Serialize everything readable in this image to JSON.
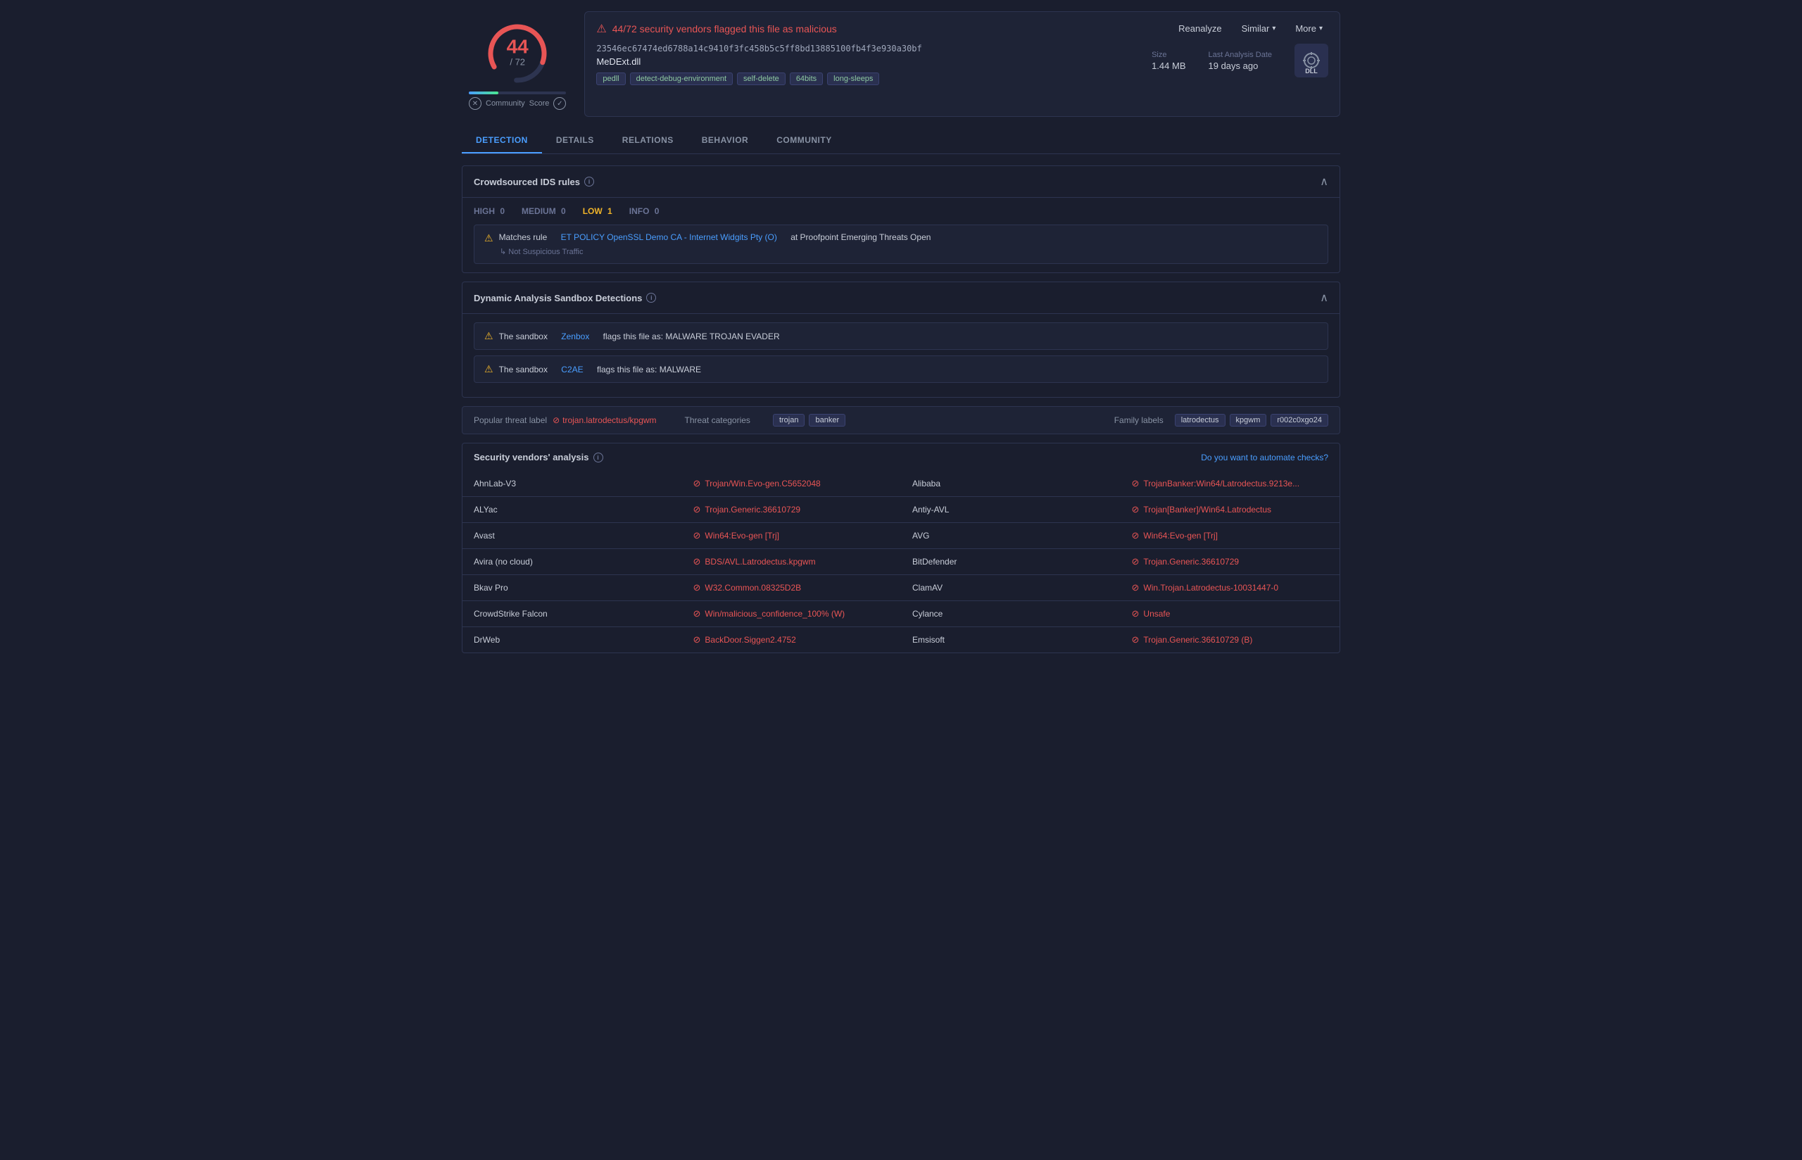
{
  "header": {
    "alert": {
      "text": "44/72 security vendors flagged this file as malicious",
      "reanalyze_label": "Reanalyze",
      "similar_label": "Similar",
      "more_label": "More"
    },
    "file": {
      "hash": "23546ec67474ed6788a14c9410f3fc458b5c5ff8bd13885100fb4f3e930a30bf",
      "name": "MeDExt.dll",
      "tags": [
        "pedll",
        "detect-debug-environment",
        "self-delete",
        "64bits",
        "long-sleeps"
      ],
      "size_label": "Size",
      "size_value": "1.44 MB",
      "last_analysis_label": "Last Analysis Date",
      "last_analysis_value": "19 days ago",
      "icon_label": "DLL"
    }
  },
  "score": {
    "number": "44",
    "denom": "/ 72",
    "community_label": "Community",
    "score_label": "Score"
  },
  "tabs": [
    {
      "label": "DETECTION",
      "active": true
    },
    {
      "label": "DETAILS",
      "active": false
    },
    {
      "label": "RELATIONS",
      "active": false
    },
    {
      "label": "BEHAVIOR",
      "active": false
    },
    {
      "label": "COMMUNITY",
      "active": false
    }
  ],
  "ids_section": {
    "title": "Crowdsourced IDS rules",
    "filters": [
      {
        "label": "HIGH",
        "value": "0"
      },
      {
        "label": "MEDIUM",
        "value": "0"
      },
      {
        "label": "LOW",
        "value": "1",
        "active": true
      },
      {
        "label": "INFO",
        "value": "0"
      }
    ],
    "rule": {
      "prefix": "Matches rule",
      "link_text": "ET POLICY OpenSSL Demo CA - Internet Widgits Pty (O)",
      "suffix": "at Proofpoint Emerging Threats Open",
      "sub_text": "Not Suspicious Traffic"
    }
  },
  "sandbox_section": {
    "title": "Dynamic Analysis Sandbox Detections",
    "rows": [
      {
        "prefix": "The sandbox",
        "sandbox": "Zenbox",
        "suffix": "flags this file as: MALWARE TROJAN EVADER"
      },
      {
        "prefix": "The sandbox",
        "sandbox": "C2AE",
        "suffix": "flags this file as: MALWARE"
      }
    ]
  },
  "threat_section": {
    "popular_threat_label": "Popular threat label",
    "popular_threat_value": "trojan.latrodectus/kpgwm",
    "categories_label": "Threat categories",
    "categories": [
      "trojan",
      "banker"
    ],
    "family_label": "Family labels",
    "families": [
      "latrodectus",
      "kpgwm",
      "r002c0xgo24"
    ]
  },
  "vendors_section": {
    "title": "Security vendors' analysis",
    "automate_text": "Do you want to automate checks?",
    "rows": [
      {
        "vendor1": "AhnLab-V3",
        "detection1": "Trojan/Win.Evo-gen.C5652048",
        "vendor2": "Alibaba",
        "detection2": "TrojanBanker:Win64/Latrodectus.9213e..."
      },
      {
        "vendor1": "ALYac",
        "detection1": "Trojan.Generic.36610729",
        "vendor2": "Antiy-AVL",
        "detection2": "Trojan[Banker]/Win64.Latrodectus"
      },
      {
        "vendor1": "Avast",
        "detection1": "Win64:Evo-gen [Trj]",
        "vendor2": "AVG",
        "detection2": "Win64:Evo-gen [Trj]"
      },
      {
        "vendor1": "Avira (no cloud)",
        "detection1": "BDS/AVL.Latrodectus.kpgwm",
        "vendor2": "BitDefender",
        "detection2": "Trojan.Generic.36610729"
      },
      {
        "vendor1": "Bkav Pro",
        "detection1": "W32.Common.08325D2B",
        "vendor2": "ClamAV",
        "detection2": "Win.Trojan.Latrodectus-10031447-0"
      },
      {
        "vendor1": "CrowdStrike Falcon",
        "detection1": "Win/malicious_confidence_100% (W)",
        "vendor2": "Cylance",
        "detection2": "Unsafe"
      },
      {
        "vendor1": "DrWeb",
        "detection1": "BackDoor.Siggen2.4752",
        "vendor2": "Emsisoft",
        "detection2": "Trojan.Generic.36610729 (B)"
      }
    ]
  }
}
